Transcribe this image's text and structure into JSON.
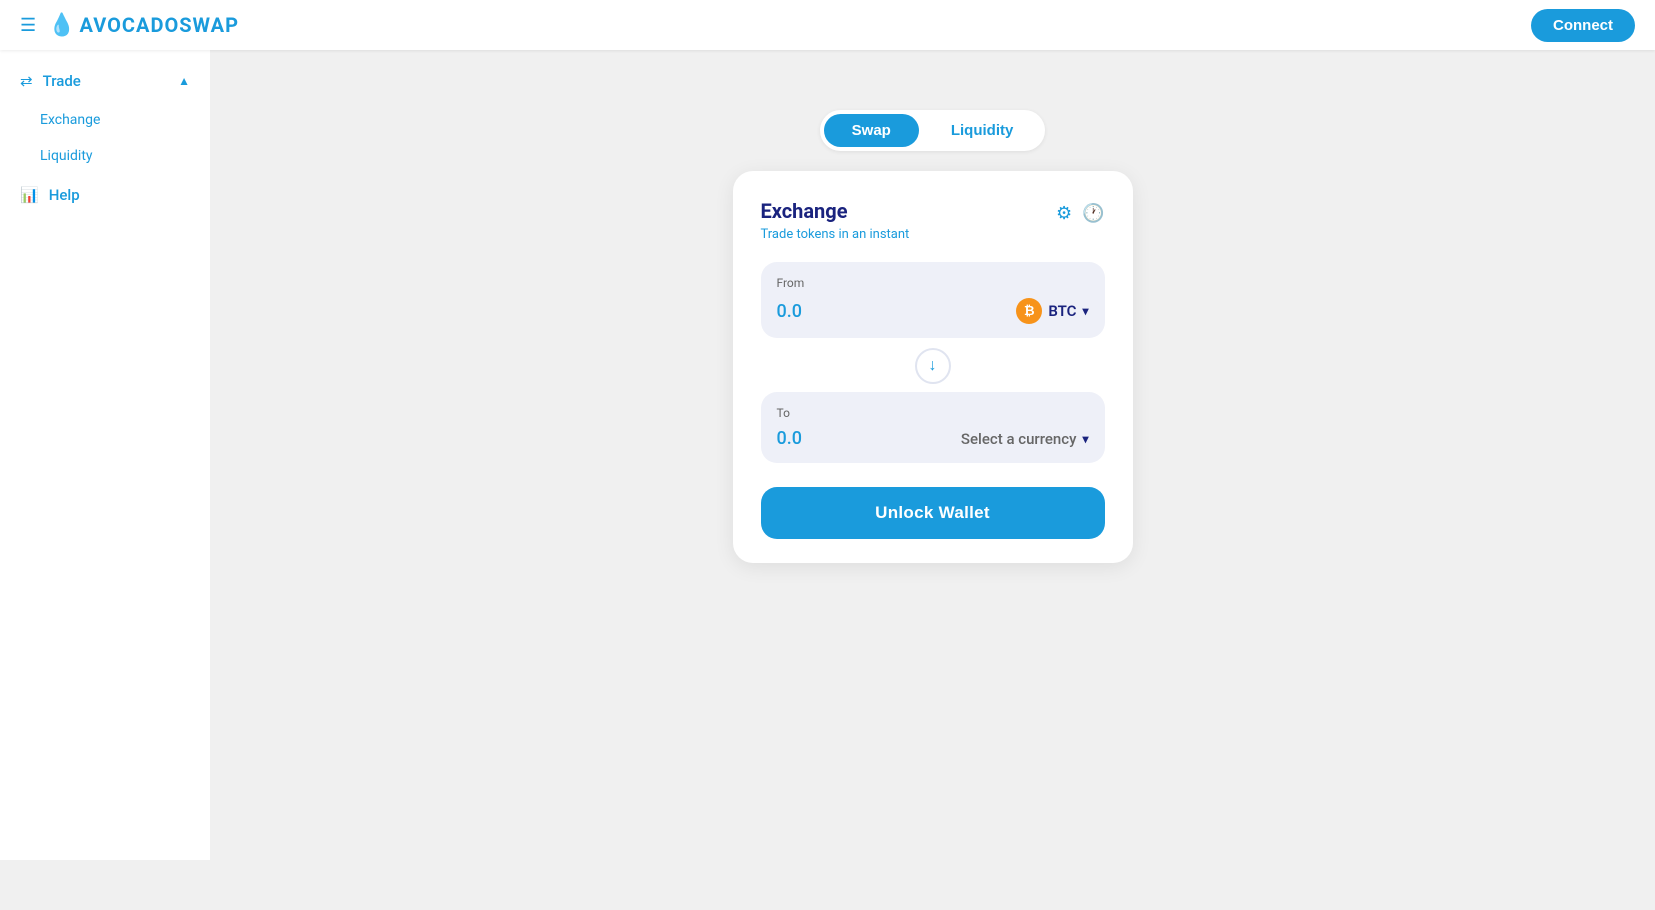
{
  "header": {
    "logo_text": "AVOCADOSWAP",
    "connect_label": "Connect"
  },
  "sidebar": {
    "trade_label": "Trade",
    "exchange_label": "Exchange",
    "liquidity_label": "Liquidity",
    "help_label": "Help"
  },
  "tabs": {
    "swap_label": "Swap",
    "liquidity_label": "Liquidity"
  },
  "exchange_card": {
    "title": "Exchange",
    "subtitle": "Trade tokens in an instant",
    "from_label": "From",
    "from_value": "0.0",
    "currency_btc": "BTC",
    "to_label": "To",
    "to_value": "0.0",
    "select_currency_label": "Select a currency",
    "unlock_label": "Unlock Wallet"
  }
}
